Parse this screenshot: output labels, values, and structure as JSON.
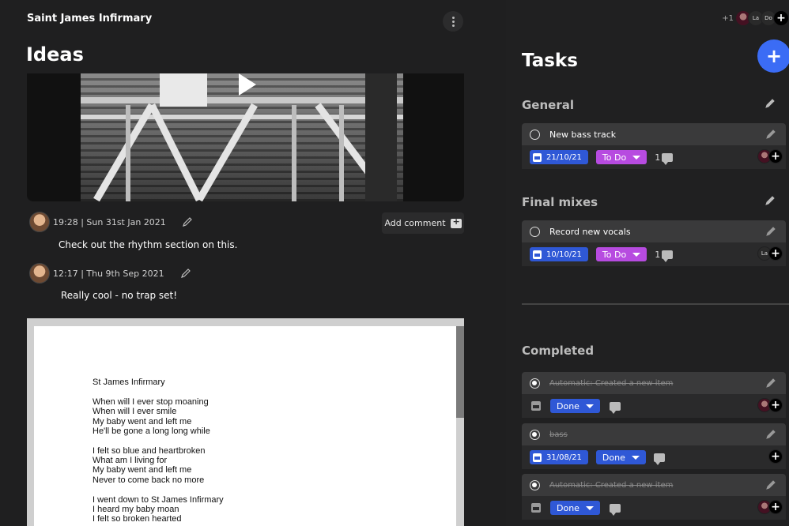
{
  "project": {
    "title": "Saint James Infirmary"
  },
  "ideas": {
    "heading": "Ideas",
    "add_comment_label": "Add comment",
    "comments": [
      {
        "meta": "19:28 | Sun 31st Jan 2021",
        "text": "Check out the rhythm section on this."
      },
      {
        "meta": "12:17 | Thu 9th Sep 2021",
        "text": "Really cool - no trap set!"
      }
    ],
    "document_lines": [
      "St James Infirmary",
      "When will I ever stop moaning",
      "When will I ever smile",
      "My baby went and left me",
      "He'll be gone a long long while",
      "I felt so blue and heartbroken",
      "What am I living for",
      "My baby went and left me",
      "Never to come back no more",
      "I went down to St James Infirmary",
      "I heard my baby moan",
      "I felt so broken hearted"
    ]
  },
  "collaborators": {
    "extra_count": "+1",
    "initials": [
      "La",
      "Do"
    ],
    "add_label": "+"
  },
  "tasks": {
    "heading": "Tasks",
    "add_label": "+",
    "groups": [
      {
        "title": "General",
        "items": [
          {
            "name": "New bass track",
            "date": "21/10/21",
            "status": "To Do",
            "comments": "1",
            "assignee": "photo"
          }
        ]
      },
      {
        "title": "Final mixes",
        "items": [
          {
            "name": "Record new vocals",
            "date": "10/10/21",
            "status": "To Do",
            "comments": "1",
            "assignee": "La"
          }
        ]
      }
    ],
    "completed": {
      "title": "Completed",
      "items": [
        {
          "name": "Automatic: Created a new item",
          "date": "",
          "status": "Done"
        },
        {
          "name": "bass",
          "date": "31/08/21",
          "status": "Done"
        },
        {
          "name": "Automatic: Created a new item",
          "date": "",
          "status": "Done"
        }
      ]
    }
  },
  "colors": {
    "accent_blue": "#3b6cf5",
    "todo_purple": "#b74be0",
    "done_blue": "#2f58d6"
  },
  "icons": [
    "kebab-icon",
    "play-icon",
    "pencil-icon",
    "comment-add-icon",
    "calendar-icon",
    "caret-down-icon",
    "speech-bubble-icon",
    "plus-icon",
    "radio-icon"
  ]
}
